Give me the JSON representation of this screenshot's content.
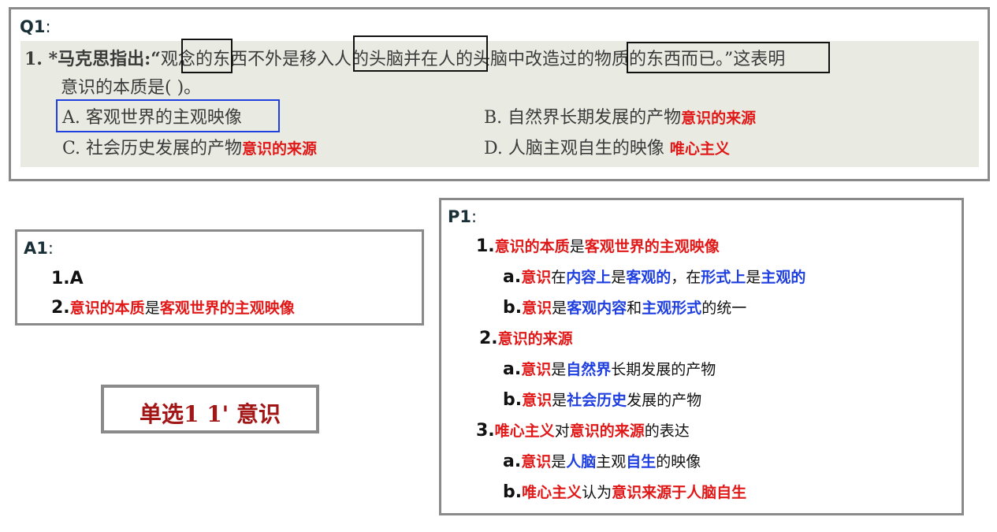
{
  "q1": {
    "label": "Q1",
    "colon": ":",
    "stem_line1_a": "1. *马克思指出:“",
    "stem_line1_b": "观念",
    "stem_line1_c": "的东西不外是",
    "stem_line1_d": "移入人的头脑",
    "stem_line1_e": "并在人的头脑中",
    "stem_line1_f": "改造过的物质的东西",
    "stem_line1_g": "而已。”这表明",
    "stem_line2": "意识的本质是(      )。",
    "option_a": "A. 客观世界的主观映像",
    "option_b": "B. 自然界长期发展的产物",
    "option_b_note": "意识的来源",
    "option_c": "C. 社会历史发展的产物",
    "option_c_note": "意识的来源",
    "option_d": "D. 人脑主观自生的映像",
    "option_d_note": "唯心主义"
  },
  "a1": {
    "label": "A1",
    "colon": ":",
    "item1": "1.A",
    "item2_num": "2.",
    "item2_red": "意识的本质",
    "item2_mid": "是",
    "item2_red2": "客观世界的主观映像"
  },
  "tag": {
    "text": "单选1 1' 意识"
  },
  "p1": {
    "label": "P1",
    "colon": ":",
    "l1_num": "1.",
    "l1_r1": "意识的本质",
    "l1_k1": "是",
    "l1_r2": "客观世界的主观映像",
    "l2_num": "a.",
    "l2_r1": "意识",
    "l2_k1": "在",
    "l2_b1": "内容上",
    "l2_k2": "是",
    "l2_b2": "客观的",
    "l2_k3": "，在",
    "l2_b3": "形式上",
    "l2_k4": "是",
    "l2_b4": "主观的",
    "l3_num": "b.",
    "l3_r1": "意识",
    "l3_k1": "是",
    "l3_b1": "客观内容",
    "l3_k2": "和",
    "l3_b2": "主观形式",
    "l3_k3": "的统一",
    "l4_num": "2.",
    "l4_r1": "意识的来源",
    "l5_num": "a.",
    "l5_r1": "意识",
    "l5_k1": "是",
    "l5_b1": "自然界",
    "l5_k2": "长期发展的产物",
    "l6_num": "b.",
    "l6_r1": "意识",
    "l6_k1": "是",
    "l6_b1": "社会历史",
    "l6_k2": "发展的产物",
    "l7_num": "3.",
    "l7_r1": "唯心主义",
    "l7_k1": "对",
    "l7_r2": "意识的来源",
    "l7_k2": "的表达",
    "l8_num": "a.",
    "l8_r1": "意识",
    "l8_k1": "是",
    "l8_b1": "人脑",
    "l8_k2": "主观",
    "l8_b2": "自生",
    "l8_k3": "的映像",
    "l9_num": "b.",
    "l9_r1": "唯心主义",
    "l9_k1": "认为",
    "l9_r2": "意识来源于人脑自生"
  },
  "colors": {
    "red": "#e11818",
    "blue": "#1f3fe0",
    "border": "#8a8a8a",
    "tag": "#a31616"
  }
}
